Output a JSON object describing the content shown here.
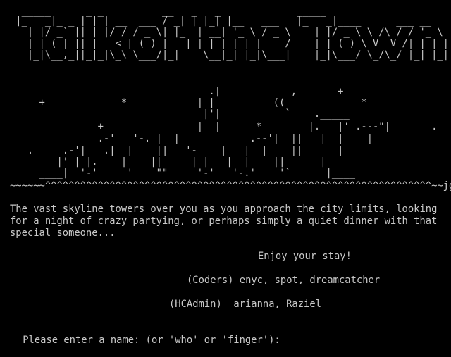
{
  "window": {
    "title": "Talk of the Town"
  },
  "colors": {
    "background": "#000000",
    "foreground": "#c8c8c8"
  },
  "banner": {
    "lines": [
      "  _____      _ _          __   _   _             _____",
      " |_   _|_ _ | | | __  ___ / _| | |_| |__   ___   |_   _|____      ___ __",
      "   | |/ _` || | |/ / / _ \\| |_  | __| '_ \\ / _ \\    | |/ _ \\ \\ /\\ / / '_ \\",
      "   | | (_| || |   < | (_) |  _| | |_| | | |  __/    | | (_) \\ V  V /| | | |",
      "   |_|\\__,_||_|_|\\_\\ \\___/|_|    \\__|_| |_|\\___|    |_|\\___/ \\_/\\_/ |_| |_|"
    ]
  },
  "skyline": {
    "lines": [
      "                                  .|            ,       +",
      "     +             *            | |          ((             *",
      "                                 |'|           `    ._____",
      "               +         ___    |  |      *        |.   |' .---\"|       .",
      "          _    .-'   '-. |  |            .--'|  ||   | _|    |",
      "   .     .-'|  _.|  |    ||   '-__  |   |  |    ||      |",
      "        |' | |.    |    ||     | |   |  |    ||      |",
      "     ____|  '-'     '    \"\"     '-'   '-.'    '`      |____",
      "~~~~~~^^^^^^^^^^^^^^^^^^^^^^^^^^^^^^^^^^^^^^^^^^^^^^^^^^^^^^^^^^^^^^^^^^~~jgs~~"
    ]
  },
  "welcome": {
    "lines": [
      "The vast skyline towers over you as you approach the city limits, looking",
      "for a night of crazy partying, or perhaps simply a quiet dinner with that",
      "special someone..."
    ],
    "enjoy": "Enjoy your stay!",
    "coders": "(Coders) enyc, spot, dreamcatcher",
    "admins": "(HCAdmin)  arianna, Raziel"
  },
  "prompt": {
    "text": "Please enter a name: (or 'who' or 'finger'):"
  }
}
